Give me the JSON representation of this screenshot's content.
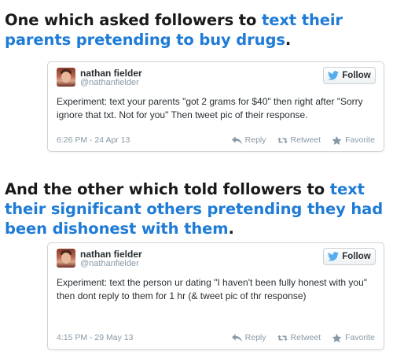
{
  "heading1": {
    "prefix": "One which asked followers to ",
    "highlight": "text their parents pretending to buy drugs",
    "suffix": "."
  },
  "heading2": {
    "prefix": "And the other which told followers to ",
    "highlight": "text their significant others pretending they had been dishonest with them",
    "suffix": "."
  },
  "tweets": [
    {
      "name": "nathan fielder",
      "handle": "@nathanfielder",
      "follow_label": "Follow",
      "text": "Experiment: text your parents \"got 2 grams for $40\" then right after \"Sorry ignore that txt. Not for you\" Then tweet pic of their response.",
      "timestamp": "6:26 PM - 24 Apr 13",
      "reply_label": "Reply",
      "retweet_label": "Retweet",
      "favorite_label": "Favorite"
    },
    {
      "name": "nathan fielder",
      "handle": "@nathanfielder",
      "follow_label": "Follow",
      "text": "Experiment: text the person ur dating \"I haven't been fully honest with you\" then dont reply to them for 1 hr (& tweet pic of thr response)",
      "timestamp": "4:15 PM - 29 May 13",
      "reply_label": "Reply",
      "retweet_label": "Retweet",
      "favorite_label": "Favorite"
    }
  ],
  "colors": {
    "highlight": "#1e7bd6",
    "twitter_bird": "#55acee",
    "meta_text": "#8899a6"
  },
  "icons": [
    "twitter-bird-icon",
    "reply-icon",
    "retweet-icon",
    "favorite-star-icon"
  ]
}
